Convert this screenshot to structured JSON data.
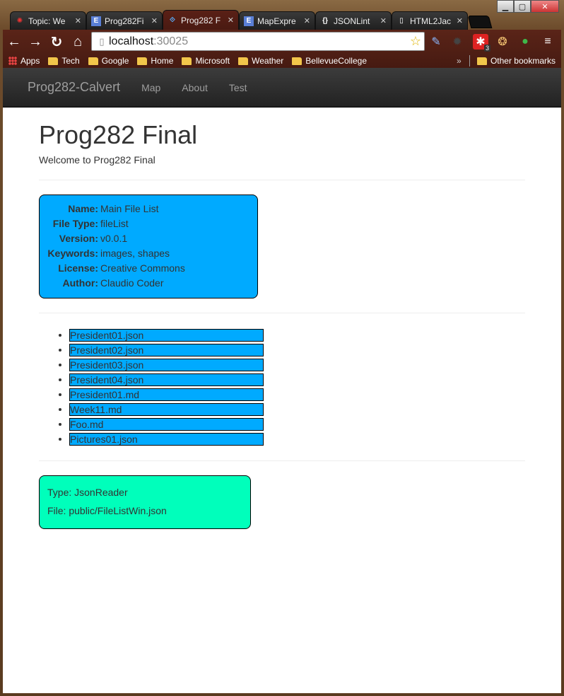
{
  "browser": {
    "tabs": [
      {
        "title": "Topic: We",
        "icon": "forum-icon",
        "active": false
      },
      {
        "title": "Prog282Fi",
        "icon": "eli-icon",
        "active": false
      },
      {
        "title": "Prog282 F",
        "icon": "dev-icon",
        "active": true
      },
      {
        "title": "MapExpre",
        "icon": "eli-icon",
        "active": false
      },
      {
        "title": "JSONLint",
        "icon": "json-icon",
        "active": false
      },
      {
        "title": "HTML2Jac",
        "icon": "page-icon",
        "active": false
      }
    ],
    "address": {
      "host": "localhost",
      "port": ":30025"
    },
    "extension_badge": "3",
    "bookmarks": [
      "Apps",
      "Tech",
      "Google",
      "Home",
      "Microsoft",
      "Weather",
      "BellevueCollege"
    ],
    "bookmarks_overflow": "»",
    "other_bookmarks": "Other bookmarks"
  },
  "navbar": {
    "brand": "Prog282-Calvert",
    "links": [
      "Map",
      "About",
      "Test"
    ]
  },
  "page": {
    "title": "Prog282 Final",
    "lead": "Welcome to Prog282 Final"
  },
  "info": {
    "rows": [
      {
        "key": "Name:",
        "value": "Main File List"
      },
      {
        "key": "File Type:",
        "value": "fileList"
      },
      {
        "key": "Version:",
        "value": "v0.0.1"
      },
      {
        "key": "Keywords:",
        "value": "images, shapes"
      },
      {
        "key": "License:",
        "value": "Creative Commons"
      },
      {
        "key": "Author:",
        "value": "Claudio Coder"
      }
    ],
    "color": "#00aaff"
  },
  "files": [
    "President01.json",
    "President02.json",
    "President03.json",
    "President04.json",
    "President01.md",
    "Week11.md",
    "Foo.md",
    "Pictures01.json"
  ],
  "reader": {
    "type_line": "Type: JsonReader",
    "file_line": "File: public/FileListWin.json",
    "color": "#00ffbb"
  }
}
